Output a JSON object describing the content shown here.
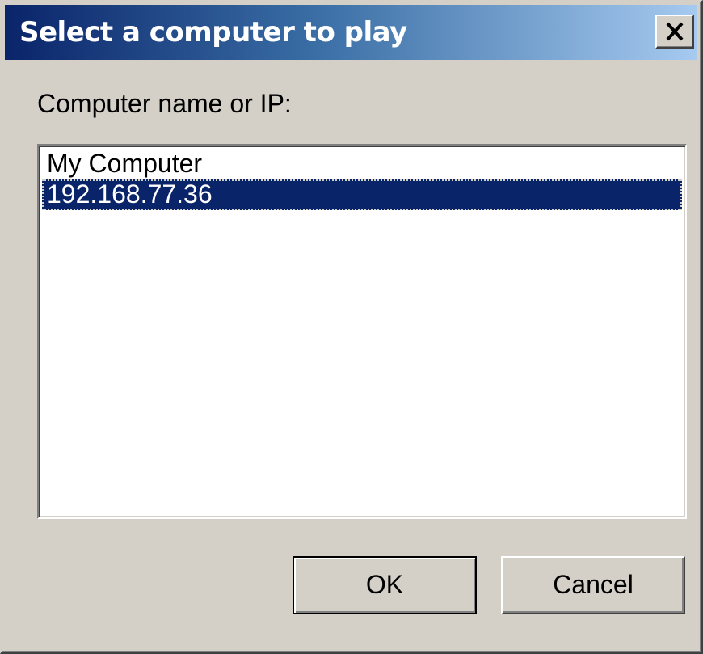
{
  "dialog": {
    "title": "Select a computer to play",
    "close_icon": "close-icon",
    "prompt_label": "Computer name or IP:",
    "computers": [
      {
        "name": "My Computer",
        "selected": false
      },
      {
        "name": "192.168.77.36",
        "selected": true
      }
    ],
    "ok_label": "OK",
    "cancel_label": "Cancel"
  },
  "colors": {
    "face": "#d4d0c8",
    "title_gradient_start": "#0a246a",
    "title_gradient_end": "#a6caf0",
    "selection": "#0a246a"
  }
}
